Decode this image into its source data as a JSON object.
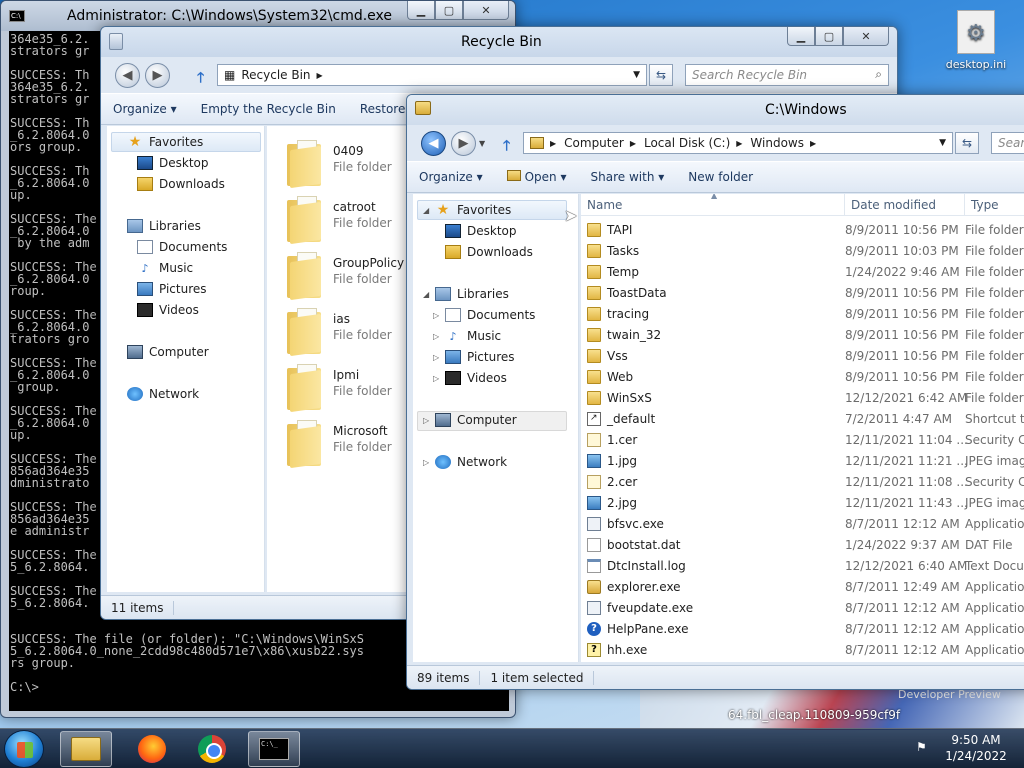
{
  "desktop": {
    "icon_label": "desktop.ini",
    "bg_text": "64.fbl_cleap.110809-959cf9f",
    "bg_text2": "Developer Preview"
  },
  "cmd": {
    "title": "Administrator: C:\\Windows\\System32\\cmd.exe",
    "lines": [
      "364e35_6.2.",
      "strators gr",
      "",
      "SUCCESS: Th",
      "364e35_6.2.",
      "strators gr",
      "",
      "SUCCESS: Th",
      "_6.2.8064.0",
      "ors group.",
      "",
      "SUCCESS: Th",
      "_6.2.8064.0",
      "up.",
      "",
      "SUCCESS: The",
      "_6.2.8064.0",
      " by the adm",
      "",
      "SUCCESS: The",
      "_6.2.8064.0",
      "roup.",
      "",
      "SUCCESS: The",
      "_6.2.8064.0",
      "trators gro",
      "",
      "SUCCESS: The",
      "_6.2.8064.0",
      " group.",
      "",
      "SUCCESS: The",
      "_6.2.8064.0",
      "up.",
      "",
      "SUCCESS: The",
      "856ad364e35",
      "dministrato",
      "",
      "SUCCESS: The",
      "856ad364e35",
      "e administr",
      "",
      "SUCCESS: The",
      "5_6.2.8064.",
      "",
      "SUCCESS: The",
      "5_6.2.8064.",
      "",
      "",
      "SUCCESS: The file (or folder): \"C:\\Windows\\WinSxS",
      "5_6.2.8064.0_none_2cdd98c480d571e7\\x86\\xusb22.sys",
      "rs group.",
      "",
      "C:\\>"
    ]
  },
  "recycle": {
    "title": "Recycle Bin",
    "address": [
      "Recycle Bin"
    ],
    "search_placeholder": "Search Recycle Bin",
    "toolbar": {
      "organize": "Organize",
      "empty": "Empty the Recycle Bin",
      "restore": "Restore"
    },
    "nav": {
      "favorites": "Favorites",
      "desktop": "Desktop",
      "downloads": "Downloads",
      "libraries": "Libraries",
      "documents": "Documents",
      "music": "Music",
      "pictures": "Pictures",
      "videos": "Videos",
      "computer": "Computer",
      "network": "Network"
    },
    "items": [
      {
        "name": "0409",
        "type": "File folder"
      },
      {
        "name": "catroot",
        "type": "File folder"
      },
      {
        "name": "GroupPolicy",
        "type": "File folder"
      },
      {
        "name": "ias",
        "type": "File folder"
      },
      {
        "name": "Ipmi",
        "type": "File folder"
      },
      {
        "name": "Microsoft",
        "type": "File folder"
      }
    ],
    "status": "11 items"
  },
  "explorer": {
    "title": "C:\\Windows",
    "address": [
      "Computer",
      "Local Disk (C:)",
      "Windows"
    ],
    "search_placeholder": "Sear",
    "toolbar": {
      "organize": "Organize",
      "open": "Open",
      "share": "Share with",
      "newfolder": "New folder"
    },
    "nav": {
      "favorites": "Favorites",
      "desktop": "Desktop",
      "downloads": "Downloads",
      "libraries": "Libraries",
      "documents": "Documents",
      "music": "Music",
      "pictures": "Pictures",
      "videos": "Videos",
      "computer": "Computer",
      "network": "Network"
    },
    "columns": {
      "name": "Name",
      "date": "Date modified",
      "type": "Type"
    },
    "files": [
      {
        "name": "TAPI",
        "date": "8/9/2011 10:56 PM",
        "type": "File folder",
        "icon": "folder"
      },
      {
        "name": "Tasks",
        "date": "8/9/2011 10:03 PM",
        "type": "File folder",
        "icon": "folder"
      },
      {
        "name": "Temp",
        "date": "1/24/2022 9:46 AM",
        "type": "File folder",
        "icon": "folder"
      },
      {
        "name": "ToastData",
        "date": "8/9/2011 10:56 PM",
        "type": "File folder",
        "icon": "folder"
      },
      {
        "name": "tracing",
        "date": "8/9/2011 10:56 PM",
        "type": "File folder",
        "icon": "folder"
      },
      {
        "name": "twain_32",
        "date": "8/9/2011 10:56 PM",
        "type": "File folder",
        "icon": "folder"
      },
      {
        "name": "Vss",
        "date": "8/9/2011 10:56 PM",
        "type": "File folder",
        "icon": "folder"
      },
      {
        "name": "Web",
        "date": "8/9/2011 10:56 PM",
        "type": "File folder",
        "icon": "folder"
      },
      {
        "name": "WinSxS",
        "date": "12/12/2021 6:42 AM",
        "type": "File folder",
        "icon": "folder"
      },
      {
        "name": "_default",
        "date": "7/2/2011 4:47 AM",
        "type": "Shortcut t",
        "icon": "shortcut"
      },
      {
        "name": "1.cer",
        "date": "12/11/2021 11:04 ...",
        "type": "Security C",
        "icon": "cert"
      },
      {
        "name": "1.jpg",
        "date": "12/11/2021 11:21 ...",
        "type": "JPEG imag",
        "icon": "jpg"
      },
      {
        "name": "2.cer",
        "date": "12/11/2021 11:08 ...",
        "type": "Security C",
        "icon": "cert"
      },
      {
        "name": "2.jpg",
        "date": "12/11/2021 11:43 ...",
        "type": "JPEG imag",
        "icon": "jpg"
      },
      {
        "name": "bfsvc.exe",
        "date": "8/7/2011 12:12 AM",
        "type": "Application",
        "icon": "exe"
      },
      {
        "name": "bootstat.dat",
        "date": "1/24/2022 9:37 AM",
        "type": "DAT File",
        "icon": "dat"
      },
      {
        "name": "DtcInstall.log",
        "date": "12/12/2021 6:40 AM",
        "type": "Text Docu",
        "icon": "log"
      },
      {
        "name": "explorer.exe",
        "date": "8/7/2011 12:49 AM",
        "type": "Application",
        "icon": "explorer"
      },
      {
        "name": "fveupdate.exe",
        "date": "8/7/2011 12:12 AM",
        "type": "Application",
        "icon": "exe"
      },
      {
        "name": "HelpPane.exe",
        "date": "8/7/2011 12:12 AM",
        "type": "Application",
        "icon": "help"
      },
      {
        "name": "hh.exe",
        "date": "8/7/2011 12:12 AM",
        "type": "Application",
        "icon": "hh"
      }
    ],
    "status_count": "89 items",
    "status_selected": "1 item selected"
  },
  "taskbar": {
    "time": "9:50 AM",
    "date": "1/24/2022"
  }
}
